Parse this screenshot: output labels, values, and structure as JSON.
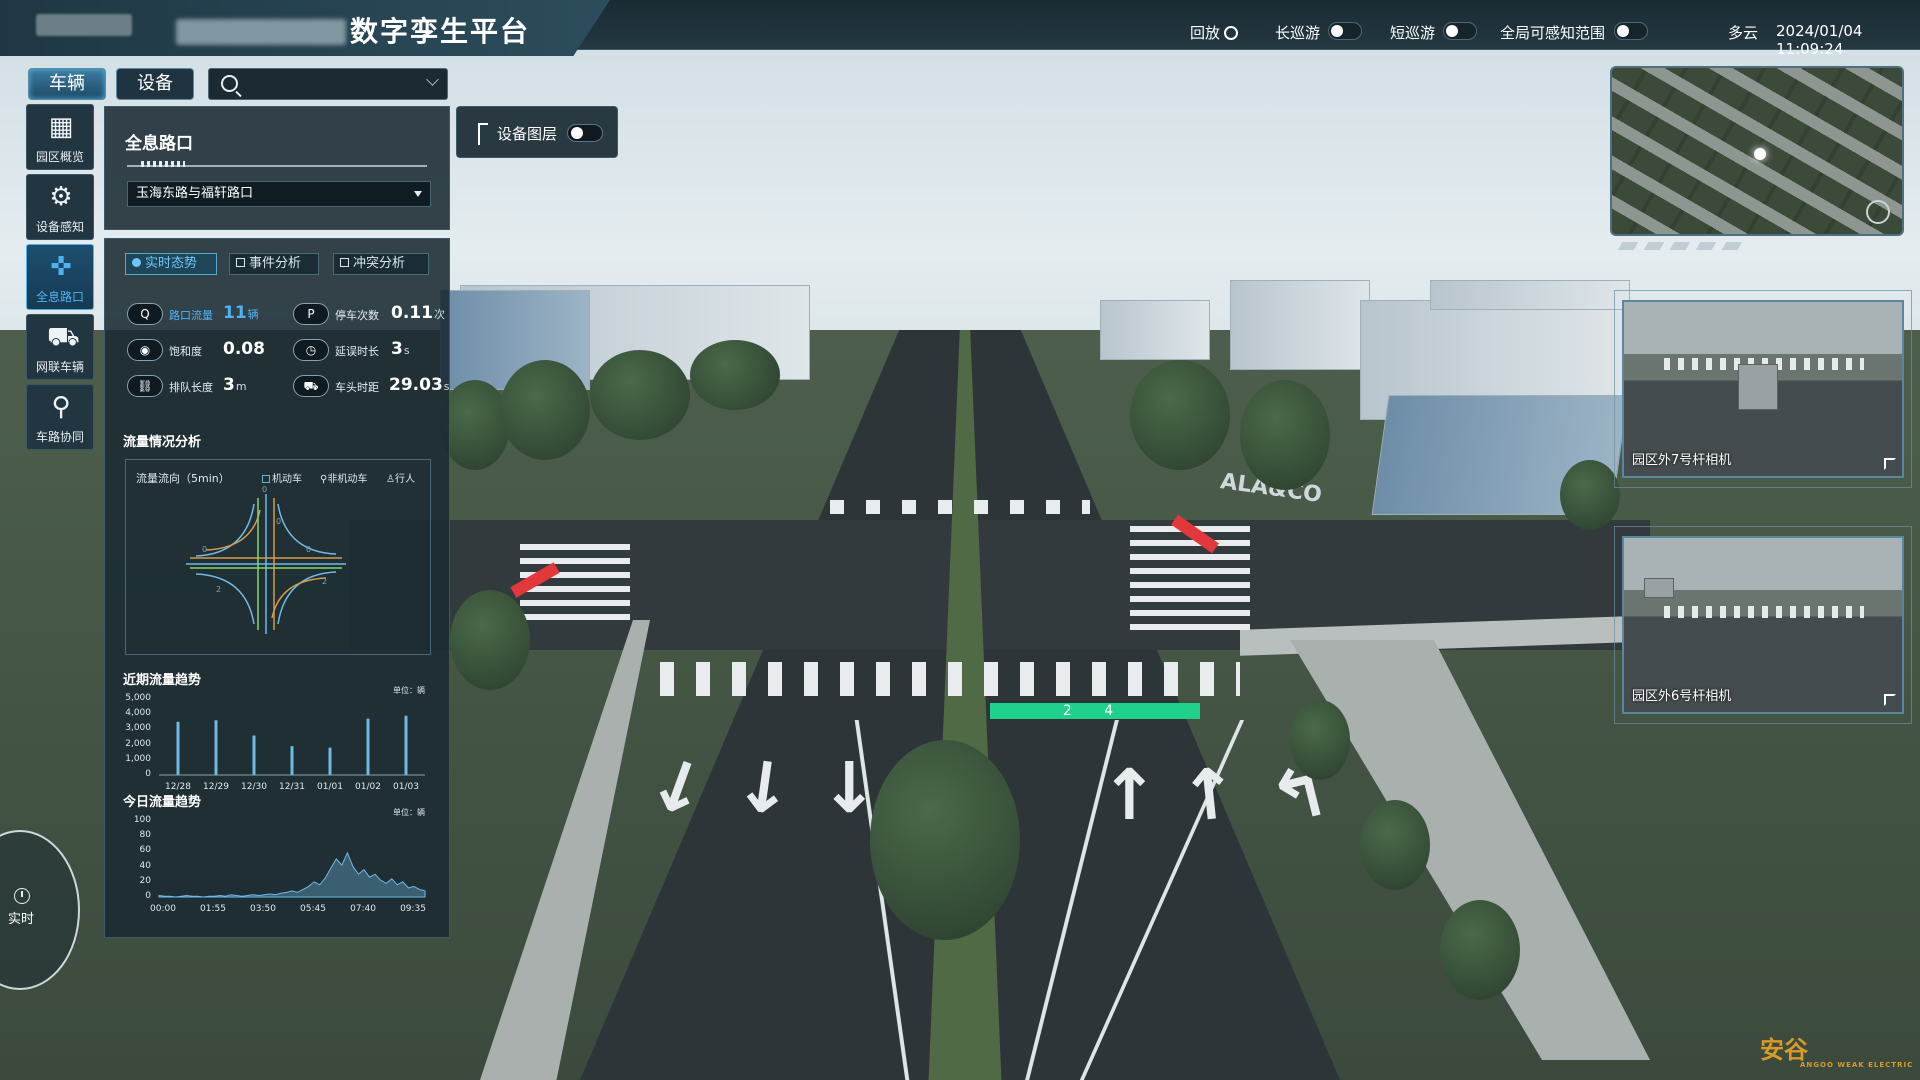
{
  "header": {
    "title_suffix": "数字孪生平台",
    "replay": "回放",
    "long_patrol": "长巡游",
    "short_patrol": "短巡游",
    "global_range": "全局可感知范围",
    "weather": "多云",
    "datetime": "2024/01/04 11:09:24"
  },
  "tabs": [
    {
      "label": "车辆",
      "active": true
    },
    {
      "label": "设备",
      "active": false
    }
  ],
  "search": {
    "placeholder": ""
  },
  "sidenav": [
    {
      "label": "园区概览",
      "icon": "dashboard-icon"
    },
    {
      "label": "设备感知",
      "icon": "gear-icon"
    },
    {
      "label": "全息路口",
      "icon": "intersection-icon",
      "active": true
    },
    {
      "label": "网联车辆",
      "icon": "car-icon"
    },
    {
      "label": "车路协同",
      "icon": "car-location-icon"
    }
  ],
  "intersection": {
    "title": "全息路口",
    "selected": "玉海东路与福轩路口"
  },
  "layer_toggle": {
    "label": "设备图层",
    "on": false
  },
  "analysis_tabs": [
    {
      "label": "实时态势",
      "active": true
    },
    {
      "label": "事件分析",
      "active": false
    },
    {
      "label": "冲突分析",
      "active": false
    }
  ],
  "metrics": [
    {
      "label": "路口流量",
      "value": "11",
      "unit": "辆",
      "highlight": true,
      "icon": "Q"
    },
    {
      "label": "停车次数",
      "value": "0.11",
      "unit": "次",
      "icon": "P"
    },
    {
      "label": "饱和度",
      "value": "0.08",
      "unit": "",
      "icon": "◉"
    },
    {
      "label": "延误时长",
      "value": "3",
      "unit": "s",
      "icon": "◷"
    },
    {
      "label": "排队长度",
      "value": "3",
      "unit": "m",
      "icon": "⛓"
    },
    {
      "label": "车头时距",
      "value": "29.03",
      "unit": "s",
      "icon": "⛟"
    }
  ],
  "flow_section": {
    "title": "流量情况分析",
    "box_title": "流量流向（5min）",
    "legend": [
      "机动车",
      "非机动车",
      "行人"
    ]
  },
  "recent_trend": {
    "title": "近期流量趋势",
    "unit": "单位：辆",
    "y_ticks": [
      "5,000",
      "4,000",
      "3,000",
      "2,000",
      "1,000",
      "0"
    ]
  },
  "today_trend": {
    "title": "今日流量趋势",
    "unit": "单位：辆",
    "y_ticks": [
      "100",
      "80",
      "60",
      "40",
      "20",
      "0"
    ]
  },
  "cameras": [
    {
      "label": "园区外7号杆相机"
    },
    {
      "label": "园区外6号杆相机"
    }
  ],
  "scene": {
    "lane_countdown": "2 4",
    "billboard": "ALA&CO"
  },
  "clock": {
    "label": "实时"
  },
  "watermark": {
    "label": "安谷",
    "sub": "ANGOO WEAK ELECTRIC"
  },
  "chart_data": [
    {
      "type": "bar",
      "title": "近期流量趋势",
      "categories": [
        "12/28",
        "12/29",
        "12/30",
        "12/31",
        "01/01",
        "01/02",
        "01/03"
      ],
      "values": [
        3500,
        3600,
        2600,
        1900,
        1800,
        3700,
        3900
      ],
      "ylim": [
        0,
        5000
      ],
      "color": "#6fb9e6"
    },
    {
      "type": "area",
      "title": "今日流量趋势",
      "x": [
        "00:00",
        "01:55",
        "03:50",
        "05:45",
        "07:40",
        "09:35"
      ],
      "values": [
        2,
        1,
        1,
        0,
        1,
        2,
        1,
        1,
        0,
        1,
        1,
        2,
        1,
        3,
        2,
        1,
        2,
        3,
        2,
        3,
        4,
        3,
        5,
        6,
        8,
        6,
        10,
        14,
        20,
        16,
        25,
        38,
        50,
        42,
        58,
        40,
        30,
        36,
        26,
        30,
        22,
        18,
        24,
        16,
        20,
        12,
        14,
        10,
        8
      ],
      "ylim": [
        0,
        100
      ],
      "color": "#6fb9e6"
    }
  ]
}
